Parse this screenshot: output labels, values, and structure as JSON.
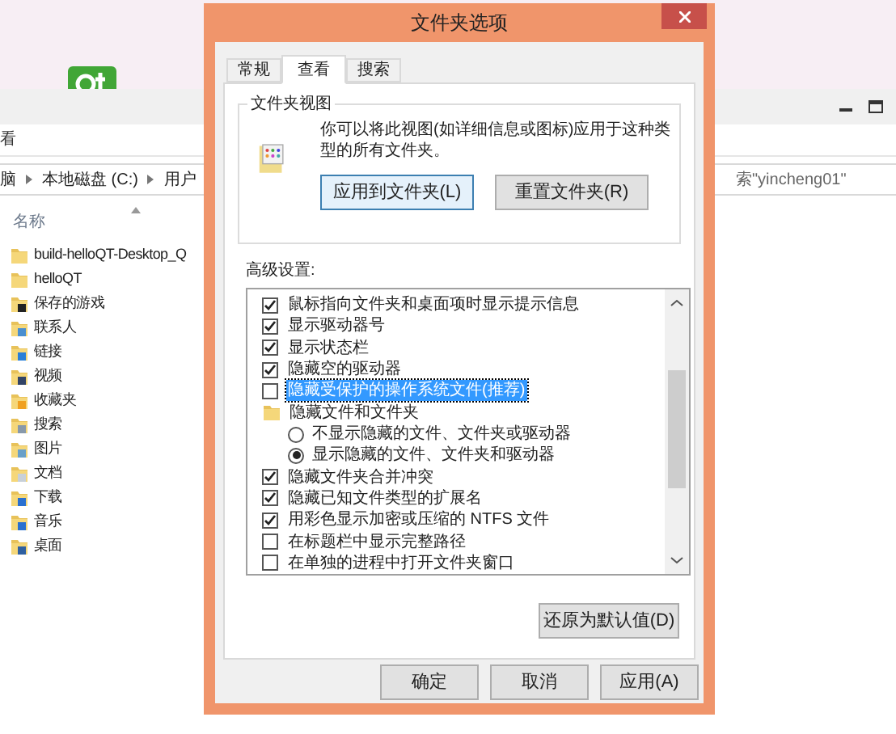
{
  "explorer": {
    "ribbon_tab": "看",
    "breadcrumbs": [
      "脑",
      "本地磁盘 (C:)",
      "用户"
    ],
    "search_text": "索\"yincheng01\"",
    "column_header": "名称",
    "files": [
      {
        "name": "build-helloQT-Desktop_Q",
        "kind": "plain"
      },
      {
        "name": "helloQT",
        "kind": "plain"
      },
      {
        "name": "保存的游戏",
        "kind": "games"
      },
      {
        "name": "联系人",
        "kind": "contacts"
      },
      {
        "name": "链接",
        "kind": "links"
      },
      {
        "name": "视频",
        "kind": "videos"
      },
      {
        "name": "收藏夹",
        "kind": "favorites"
      },
      {
        "name": "搜索",
        "kind": "searches"
      },
      {
        "name": "图片",
        "kind": "pictures"
      },
      {
        "name": "文档",
        "kind": "documents"
      },
      {
        "name": "下载",
        "kind": "downloads"
      },
      {
        "name": "音乐",
        "kind": "music"
      },
      {
        "name": "桌面",
        "kind": "desktop"
      }
    ]
  },
  "dialog": {
    "title": "文件夹选项",
    "tabs": [
      {
        "label": "常规",
        "selected": false
      },
      {
        "label": "查看",
        "selected": true
      },
      {
        "label": "搜索",
        "selected": false
      }
    ],
    "folder_views": {
      "title": "文件夹视图",
      "description": "你可以将此视图(如详细信息或图标)应用于这种类型的所有文件夹。",
      "buttons": [
        {
          "label": "应用到文件夹(L)",
          "default": true
        },
        {
          "label": "重置文件夹(R)",
          "default": false
        }
      ]
    },
    "advanced_label": "高级设置:",
    "settings": [
      {
        "kind": "checkbox",
        "label": "鼠标指向文件夹和桌面项时显示提示信息",
        "checked": true,
        "selected": false
      },
      {
        "kind": "checkbox",
        "label": "显示驱动器号",
        "checked": true,
        "selected": false
      },
      {
        "kind": "checkbox",
        "label": "显示状态栏",
        "checked": true,
        "selected": false
      },
      {
        "kind": "checkbox",
        "label": "隐藏空的驱动器",
        "checked": true,
        "selected": false
      },
      {
        "kind": "checkbox",
        "label": "隐藏受保护的操作系统文件(推荐)",
        "checked": false,
        "selected": true
      },
      {
        "kind": "group",
        "label": "隐藏文件和文件夹",
        "children": [
          {
            "kind": "radio",
            "label": "不显示隐藏的文件、文件夹或驱动器",
            "selected": false
          },
          {
            "kind": "radio",
            "label": "显示隐藏的文件、文件夹和驱动器",
            "selected": true
          }
        ]
      },
      {
        "kind": "checkbox",
        "label": "隐藏文件夹合并冲突",
        "checked": true,
        "selected": false
      },
      {
        "kind": "checkbox",
        "label": "隐藏已知文件类型的扩展名",
        "checked": true,
        "selected": false
      },
      {
        "kind": "checkbox",
        "label": "用彩色显示加密或压缩的 NTFS 文件",
        "checked": true,
        "selected": false
      },
      {
        "kind": "checkbox",
        "label": "在标题栏中显示完整路径",
        "checked": false,
        "selected": false
      },
      {
        "kind": "checkbox",
        "label": "在单独的进程中打开文件夹窗口",
        "checked": false,
        "selected": false
      }
    ],
    "restore_button": "还原为默认值(D)",
    "buttons": [
      "确定",
      "取消",
      "应用(A)"
    ]
  }
}
